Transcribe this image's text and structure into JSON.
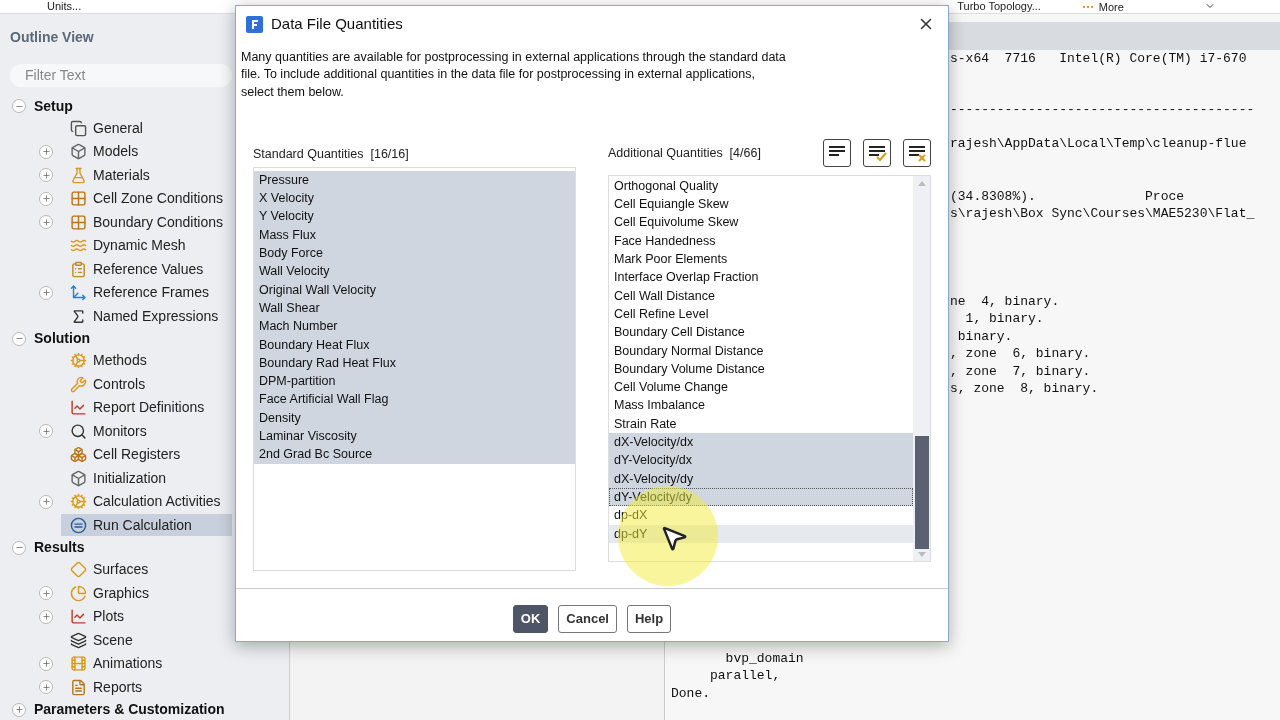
{
  "toolbar": [
    {
      "label": "Units..."
    },
    {
      "label": "Turbo Topology..."
    },
    {
      "label": "More"
    }
  ],
  "outline": {
    "title": "Outline View",
    "filter": {
      "placeholder": "Filter Text"
    },
    "sections": [
      {
        "label": "Setup",
        "expanded": true,
        "children": [
          {
            "label": "General",
            "kind": "copy",
            "expandable": false,
            "selected": false
          },
          {
            "label": "Models",
            "kind": "box",
            "expandable": true,
            "selected": false
          },
          {
            "label": "Materials",
            "kind": "flask",
            "expandable": true,
            "selected": false
          },
          {
            "label": "Cell Zone Conditions",
            "kind": "grid",
            "expandable": true,
            "selected": false
          },
          {
            "label": "Boundary Conditions",
            "kind": "grid",
            "expandable": true,
            "selected": false
          },
          {
            "label": "Dynamic Mesh",
            "kind": "waves",
            "expandable": false,
            "selected": false
          },
          {
            "label": "Reference Values",
            "kind": "clipboard",
            "expandable": false,
            "selected": false
          },
          {
            "label": "Reference Frames",
            "kind": "axis",
            "expandable": true,
            "selected": false
          },
          {
            "label": "Named Expressions",
            "kind": "function",
            "expandable": false,
            "selected": false
          }
        ]
      },
      {
        "label": "Solution",
        "expanded": true,
        "children": [
          {
            "label": "Methods",
            "kind": "cog",
            "expandable": false,
            "selected": false
          },
          {
            "label": "Controls",
            "kind": "wrench",
            "expandable": false,
            "selected": false
          },
          {
            "label": "Report Definitions",
            "kind": "chart",
            "expandable": false,
            "selected": false
          },
          {
            "label": "Monitors",
            "kind": "search",
            "expandable": true,
            "selected": false
          },
          {
            "label": "Cell Registers",
            "kind": "boxes",
            "expandable": false,
            "selected": false
          },
          {
            "label": "Initialization",
            "kind": "box",
            "expandable": false,
            "selected": false
          },
          {
            "label": "Calculation Activities",
            "kind": "cog",
            "expandable": true,
            "selected": false
          },
          {
            "label": "Run Calculation",
            "kind": "equal",
            "expandable": false,
            "selected": true
          }
        ]
      },
      {
        "label": "Results",
        "expanded": true,
        "children": [
          {
            "label": "Surfaces",
            "kind": "diamond",
            "expandable": false,
            "selected": false
          },
          {
            "label": "Graphics",
            "kind": "pie",
            "expandable": true,
            "selected": false
          },
          {
            "label": "Plots",
            "kind": "chart",
            "expandable": true,
            "selected": false
          },
          {
            "label": "Scene",
            "kind": "layers",
            "expandable": false,
            "selected": false
          },
          {
            "label": "Animations",
            "kind": "film",
            "expandable": true,
            "selected": false
          },
          {
            "label": "Reports",
            "kind": "file",
            "expandable": true,
            "selected": false
          }
        ]
      },
      {
        "label": "Parameters & Customization",
        "expanded": false
      }
    ]
  },
  "console": {
    "top_blocks": [
      {
        "lines": [
          "s-x64  7716   Intel(R) Core(TM) i7-670"
        ]
      },
      {
        "lines": [
          "---------------------------------------"
        ]
      },
      {
        "lines": [
          "rajesh\\AppData\\Local\\Temp\\cleanup-flue"
        ]
      },
      {
        "lines": [
          "(34.8308%).              Proce",
          "s\\rajesh\\Box Sync\\Courses\\MAE5230\\Flat_"
        ]
      },
      {
        "lines": [
          "ne  4, binary.",
          "  1, binary.",
          " binary.",
          ", zone  6, binary.",
          ", zone  7, binary.",
          "s, zone  8, binary."
        ]
      }
    ],
    "bottom_lines": [
      "       bvp_domain",
      "     parallel,",
      "Done."
    ]
  },
  "dialog": {
    "title": "Data File Quantities",
    "description": "Many quantities are available for postprocessing in external applications through the standard data file. To include additional quantities in the data file for postprocessing in external applications, select them below.",
    "standard": {
      "label": "Standard Quantities",
      "count": "[16/16]",
      "items": [
        {
          "label": "Pressure",
          "selected": true
        },
        {
          "label": "X Velocity",
          "selected": true
        },
        {
          "label": "Y Velocity",
          "selected": true
        },
        {
          "label": "Mass Flux",
          "selected": true
        },
        {
          "label": "Body Force",
          "selected": true
        },
        {
          "label": "Wall Velocity",
          "selected": true
        },
        {
          "label": "Original Wall Velocity",
          "selected": true
        },
        {
          "label": "Wall Shear",
          "selected": true
        },
        {
          "label": "Mach Number",
          "selected": true
        },
        {
          "label": "Boundary Heat Flux",
          "selected": true
        },
        {
          "label": "Boundary Rad Heat Flux",
          "selected": true
        },
        {
          "label": "DPM-partition",
          "selected": true
        },
        {
          "label": "Face Artificial Wall Flag",
          "selected": true
        },
        {
          "label": "Density",
          "selected": true
        },
        {
          "label": "Laminar Viscosity",
          "selected": true
        },
        {
          "label": "2nd Grad Bc Source",
          "selected": true
        }
      ]
    },
    "additional": {
      "label": "Additional Quantities",
      "count": "[4/66]",
      "items": [
        {
          "label": "Orthogonal Quality",
          "selected": false,
          "focused": false,
          "hovered": false
        },
        {
          "label": "Cell Equiangle Skew",
          "selected": false,
          "focused": false,
          "hovered": false
        },
        {
          "label": "Cell Equivolume Skew",
          "selected": false,
          "focused": false,
          "hovered": false
        },
        {
          "label": "Face Handedness",
          "selected": false,
          "focused": false,
          "hovered": false
        },
        {
          "label": "Mark Poor Elements",
          "selected": false,
          "focused": false,
          "hovered": false
        },
        {
          "label": "Interface Overlap Fraction",
          "selected": false,
          "focused": false,
          "hovered": false
        },
        {
          "label": "Cell Wall Distance",
          "selected": false,
          "focused": false,
          "hovered": false
        },
        {
          "label": "Cell Refine Level",
          "selected": false,
          "focused": false,
          "hovered": false
        },
        {
          "label": "Boundary Cell Distance",
          "selected": false,
          "focused": false,
          "hovered": false
        },
        {
          "label": "Boundary Normal Distance",
          "selected": false,
          "focused": false,
          "hovered": false
        },
        {
          "label": "Boundary Volume Distance",
          "selected": false,
          "focused": false,
          "hovered": false
        },
        {
          "label": "Cell Volume Change",
          "selected": false,
          "focused": false,
          "hovered": false
        },
        {
          "label": "Mass Imbalance",
          "selected": false,
          "focused": false,
          "hovered": false
        },
        {
          "label": "Strain Rate",
          "selected": false,
          "focused": false,
          "hovered": false
        },
        {
          "label": "dX-Velocity/dx",
          "selected": true,
          "focused": false,
          "hovered": false
        },
        {
          "label": "dY-Velocity/dx",
          "selected": true,
          "focused": false,
          "hovered": false
        },
        {
          "label": "dX-Velocity/dy",
          "selected": true,
          "focused": false,
          "hovered": false
        },
        {
          "label": "dY-Velocity/dy",
          "selected": true,
          "focused": true,
          "hovered": false
        },
        {
          "label": "dp-dX",
          "selected": false,
          "focused": false,
          "hovered": false
        },
        {
          "label": "dp-dY",
          "selected": false,
          "focused": false,
          "hovered": true
        }
      ]
    },
    "buttons": [
      {
        "label": "OK",
        "primary": true
      },
      {
        "label": "Cancel",
        "primary": false
      },
      {
        "label": "Help",
        "primary": false
      }
    ]
  }
}
